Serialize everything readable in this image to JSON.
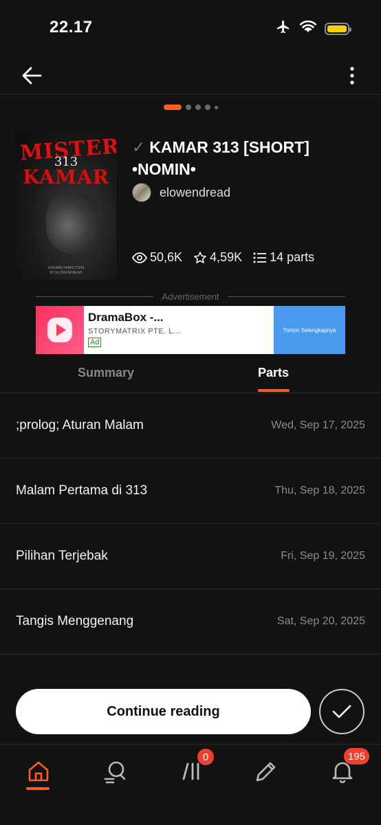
{
  "status_bar": {
    "time": "22.17",
    "icons": [
      "airplane-icon",
      "wifi-icon",
      "battery-icon"
    ],
    "battery_color": "#f5d100"
  },
  "topbar": {
    "back_icon": "arrow-left-icon",
    "more_icon": "more-vertical-icon"
  },
  "pager": {
    "count": 5,
    "active_index": 0,
    "accent": "#ff5e23"
  },
  "cover": {
    "title_line1": "MISTERI",
    "title_number": "313",
    "title_line2": "KAMAR",
    "credit_line1": "A NOMIN FANFICTION",
    "credit_line2": "BY ELOWENDREAD"
  },
  "story": {
    "verified_glyph": "✓",
    "title": "KAMAR 313 [SHORT] •NOMIN•",
    "author": "elowendread",
    "views": "50,6K",
    "votes": "4,59K",
    "parts": "14 parts"
  },
  "ad": {
    "label": "Advertisement",
    "title": "DramaBox -...",
    "publisher": "STORYMATRIX PTE. L...",
    "badge": "Ad",
    "cta": "Tonton Selengkapnya"
  },
  "tabs": [
    {
      "label": "Summary",
      "active": false
    },
    {
      "label": "Parts",
      "active": true
    }
  ],
  "parts_list": [
    {
      "title": ";prolog; Aturan Malam",
      "date": "Wed, Sep 17, 2025"
    },
    {
      "title": "Malam Pertama di 313",
      "date": "Thu, Sep 18, 2025"
    },
    {
      "title": "Pilihan Terjebak",
      "date": "Fri, Sep 19, 2025"
    },
    {
      "title": "Tangis Menggenang",
      "date": "Sat, Sep 20, 2025"
    }
  ],
  "actions": {
    "continue_label": "Continue reading",
    "check_icon": "check-icon"
  },
  "bottom_nav": {
    "items": [
      "home-icon",
      "search-icon",
      "library-icon",
      "pencil-icon",
      "bell-icon"
    ],
    "library_badge": "0",
    "notifications_badge": "195",
    "accent": "#ff5e23"
  }
}
